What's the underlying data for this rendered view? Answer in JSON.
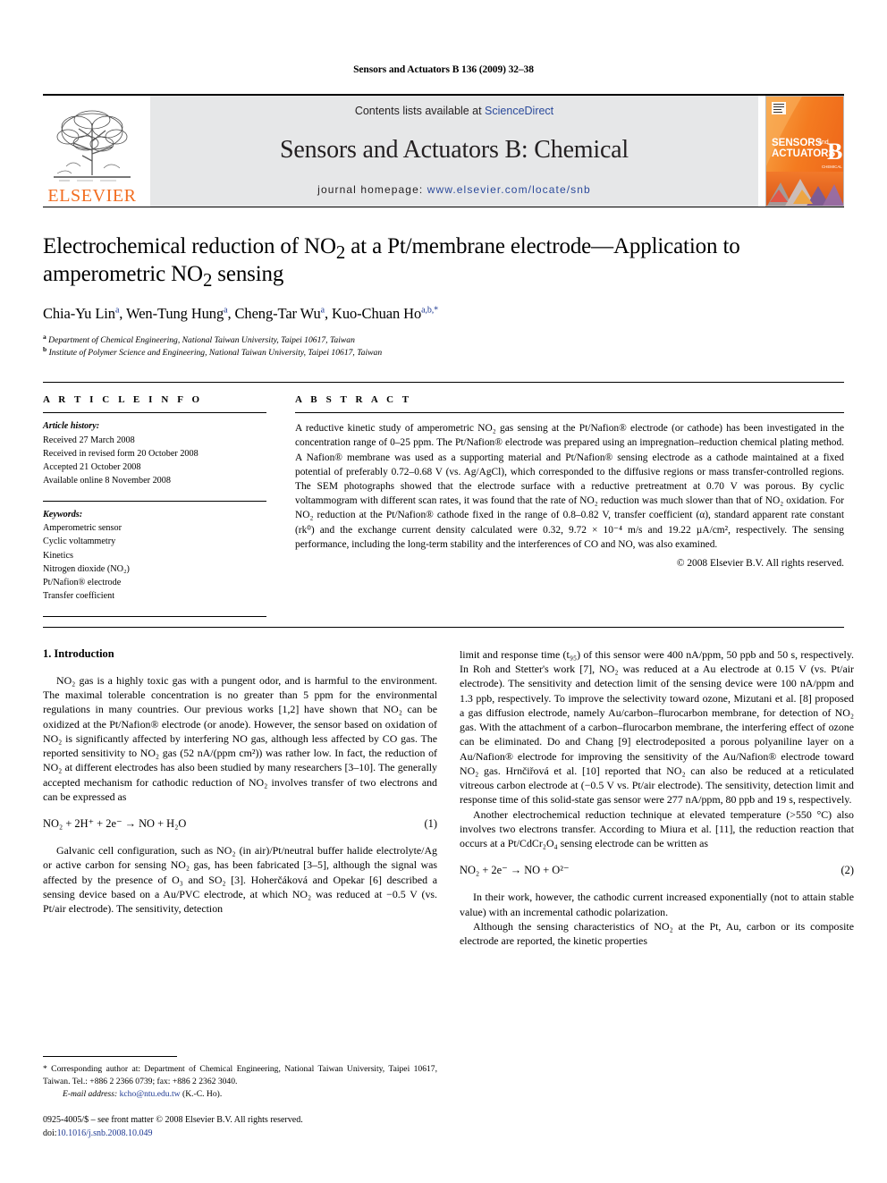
{
  "running_head": "Sensors and Actuators B 136 (2009) 32–38",
  "masthead": {
    "publisher_name": "ELSEVIER",
    "contents_prefix": "Contents lists available at ",
    "sciencedirect": "ScienceDirect",
    "journal_title": "Sensors and Actuators B: Chemical",
    "homepage_label": "journal homepage:",
    "homepage_url": "www.elsevier.com/locate/snb",
    "cover": {
      "line1": "SENSORS",
      "line1_small": "and",
      "line2": "ACTUATORS",
      "letter": "B",
      "sublabel": "CHEMICAL"
    },
    "accent_orange": "#f26d20",
    "band_gray": "#e6e7e8",
    "link_blue": "#2b4a9b"
  },
  "title": {
    "line1_pre": "Electrochemical reduction of NO",
    "line1_sub": "2",
    "line1_post": " at a Pt/membrane electrode—Application to",
    "line2_pre": "amperometric NO",
    "line2_sub": "2",
    "line2_post": " sensing"
  },
  "authors": [
    {
      "name": "Chia-Yu Lin",
      "marks": "a",
      "sep": ", "
    },
    {
      "name": "Wen-Tung Hung",
      "marks": "a",
      "sep": ", "
    },
    {
      "name": "Cheng-Tar Wu",
      "marks": "a",
      "sep": ", "
    },
    {
      "name": "Kuo-Chuan Ho",
      "marks": "a,b,*",
      "sep": ""
    }
  ],
  "affiliations": [
    {
      "mark": "a",
      "text": "Department of Chemical Engineering, National Taiwan University, Taipei 10617, Taiwan"
    },
    {
      "mark": "b",
      "text": "Institute of Polymer Science and Engineering, National Taiwan University, Taipei 10617, Taiwan"
    }
  ],
  "article_info": {
    "heading": "A R T I C L E    I N F O",
    "history_heading": "Article history:",
    "history": [
      "Received 27 March 2008",
      "Received in revised form 20 October 2008",
      "Accepted 21 October 2008",
      "Available online 8 November 2008"
    ],
    "keywords_heading": "Keywords:",
    "keywords": [
      "Amperometric sensor",
      "Cyclic voltammetry",
      "Kinetics",
      "Nitrogen dioxide (NO₂)",
      "Pt/Nafion® electrode",
      "Transfer coefficient"
    ]
  },
  "abstract": {
    "heading": "A B S T R A C T",
    "body": "A reductive kinetic study of amperometric NO₂ gas sensing at the Pt/Nafion® electrode (or cathode) has been investigated in the concentration range of 0–25 ppm. The Pt/Nafion® electrode was prepared using an impregnation–reduction chemical plating method. A Nafion® membrane was used as a supporting material and Pt/Nafion® sensing electrode as a cathode maintained at a fixed potential of preferably 0.72–0.68 V (vs. Ag/AgCl), which corresponded to the diffusive regions or mass transfer-controlled regions. The SEM photographs showed that the electrode surface with a reductive pretreatment at 0.70 V was porous. By cyclic voltammogram with different scan rates, it was found that the rate of NO₂ reduction was much slower than that of NO₂ oxidation. For NO₂ reduction at the Pt/Nafion® cathode fixed in the range of 0.8–0.82 V, transfer coefficient (α), standard apparent rate constant (rk⁰) and the exchange current density calculated were 0.32, 9.72 × 10⁻⁴ m/s and 19.22 µA/cm², respectively. The sensing performance, including the long-term stability and the interferences of CO and NO, was also examined.",
    "copyright": "© 2008 Elsevier B.V. All rights reserved."
  },
  "body": {
    "section_heading": "1.  Introduction",
    "left_paragraphs": [
      "NO₂ gas is a highly toxic gas with a pungent odor, and is harmful to the environment. The maximal tolerable concentration is no greater than 5 ppm for the environmental regulations in many countries. Our previous works [1,2] have shown that NO₂ can be oxidized at the Pt/Nafion® electrode (or anode). However, the sensor based on oxidation of NO₂ is significantly affected by interfering NO gas, although less affected by CO gas. The reported sensitivity to NO₂ gas (52 nA/(ppm cm²)) was rather low. In fact, the reduction of NO₂ at different electrodes has also been studied by many researchers [3–10]. The generally accepted mechanism for cathodic reduction of NO₂ involves transfer of two electrons and can be expressed as",
      "Galvanic cell configuration, such as NO₂ (in air)/Pt/neutral buffer halide electrolyte/Ag or active carbon for sensing NO₂ gas, has been fabricated [3–5], although the signal was affected by the presence of O₃ and SO₂ [3]. Hoherčáková and Opekar [6] described a sensing device based on a Au/PVC electrode, at which NO₂ was reduced at −0.5 V (vs. Pt/air electrode). The sensitivity, detection"
    ],
    "right_paragraphs": [
      "limit and response time (t₉₅) of this sensor were 400 nA/ppm, 50 ppb and 50 s, respectively. In Roh and Stetter's work [7], NO₂ was reduced at a Au electrode at 0.15 V (vs. Pt/air electrode). The sensitivity and detection limit of the sensing device were 100 nA/ppm and 1.3 ppb, respectively. To improve the selectivity toward ozone, Mizutani et al. [8] proposed a gas diffusion electrode, namely Au/carbon–flurocarbon membrane, for detection of NO₂ gas. With the attachment of a carbon–flurocarbon membrane, the interfering effect of ozone can be eliminated. Do and Chang [9] electrodeposited a porous polyaniline layer on a Au/Nafion® electrode for improving the sensitivity of the Au/Nafion® electrode toward NO₂ gas. Hrnčiřová et al. [10] reported that NO₂ can also be reduced at a reticulated vitreous carbon electrode at (−0.5 V vs. Pt/air electrode). The sensitivity, detection limit and response time of this solid-state gas sensor were 277 nA/ppm, 80 ppb and 19 s, respectively.",
      "Another electrochemical reduction technique at elevated temperature (>550 °C) also involves two electrons transfer. According to Miura et al. [11], the reduction reaction that occurs at a Pt/CdCr₂O₄ sensing electrode can be written as",
      "In their work, however, the cathodic current increased exponentially (not to attain stable value) with an incremental cathodic polarization.",
      "Although the sensing characteristics of NO₂ at the Pt, Au, carbon or its composite electrode are reported, the kinetic properties"
    ],
    "equation1": {
      "text": "NO₂ + 2H⁺ + 2e⁻ →  NO + H₂O",
      "number": "(1)"
    },
    "equation2": {
      "text": "NO₂ + 2e⁻ →  NO + O²⁻",
      "number": "(2)"
    }
  },
  "footnotes": {
    "corresponding": "*  Corresponding author at: Department of Chemical Engineering, National Taiwan University, Taipei 10617, Taiwan. Tel.: +886 2 2366 0739; fax: +886 2 2362 3040.",
    "email_label": "E-mail address:",
    "email": "kcho@ntu.edu.tw",
    "email_suffix": "(K.-C. Ho).",
    "issn_line": "0925-4005/$ – see front matter © 2008 Elsevier B.V. All rights reserved.",
    "doi_label": "doi:",
    "doi_value": "10.1016/j.snb.2008.10.049"
  }
}
